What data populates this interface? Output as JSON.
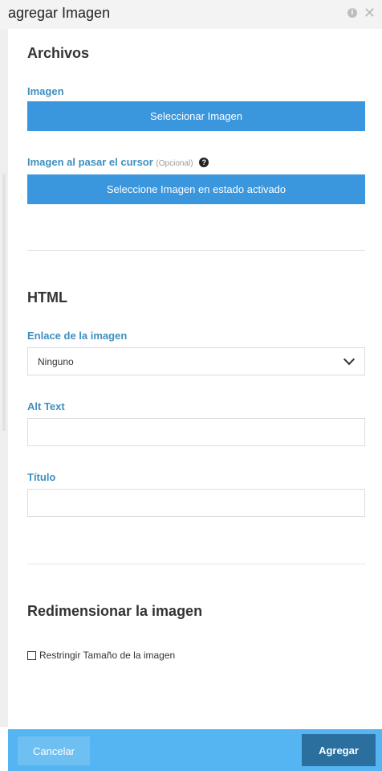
{
  "window": {
    "title": "agregar Imagen"
  },
  "files": {
    "section_title": "Archivos",
    "image_label": "Imagen",
    "select_image_button": "Seleccionar Imagen",
    "hover_image_label": "Imagen al pasar el cursor",
    "hover_image_optional": "(Opcional)",
    "hover_image_button": "Seleccione Imagen en estado activado"
  },
  "html": {
    "section_title": "HTML",
    "link_label": "Enlace de la imagen",
    "link_value": "Ninguno",
    "alt_label": "Alt Text",
    "alt_value": "",
    "title_label": "Título",
    "title_value": ""
  },
  "resize": {
    "section_title": "Redimensionar la imagen",
    "restrict_label": "Restringir Tamaño de la imagen",
    "restrict_checked": false
  },
  "footer": {
    "cancel_label": "Cancelar",
    "add_label": "Agregar"
  }
}
